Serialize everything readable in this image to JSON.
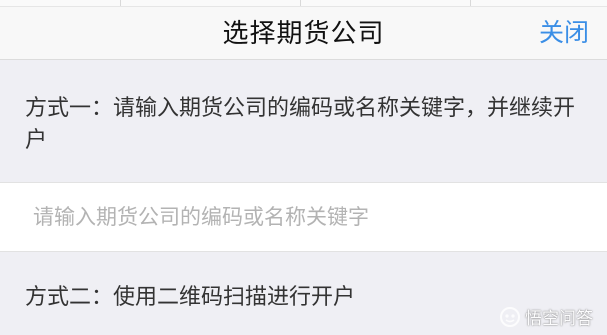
{
  "header": {
    "title": "选择期货公司",
    "close_label": "关闭"
  },
  "method1": {
    "text": "方式一：请输入期货公司的编码或名称关键字，并继续开户"
  },
  "search": {
    "placeholder": "请输入期货公司的编码或名称关键字",
    "value": ""
  },
  "method2": {
    "text": "方式二：使用二维码扫描进行开户"
  },
  "watermark": {
    "text": "悟空问答",
    "icon": "wukong-logo-icon"
  },
  "colors": {
    "background": "#efeff4",
    "nav_background": "#f8f8f8",
    "accent": "#3a8ee6",
    "text": "#333333",
    "placeholder": "#b3b3b3"
  }
}
